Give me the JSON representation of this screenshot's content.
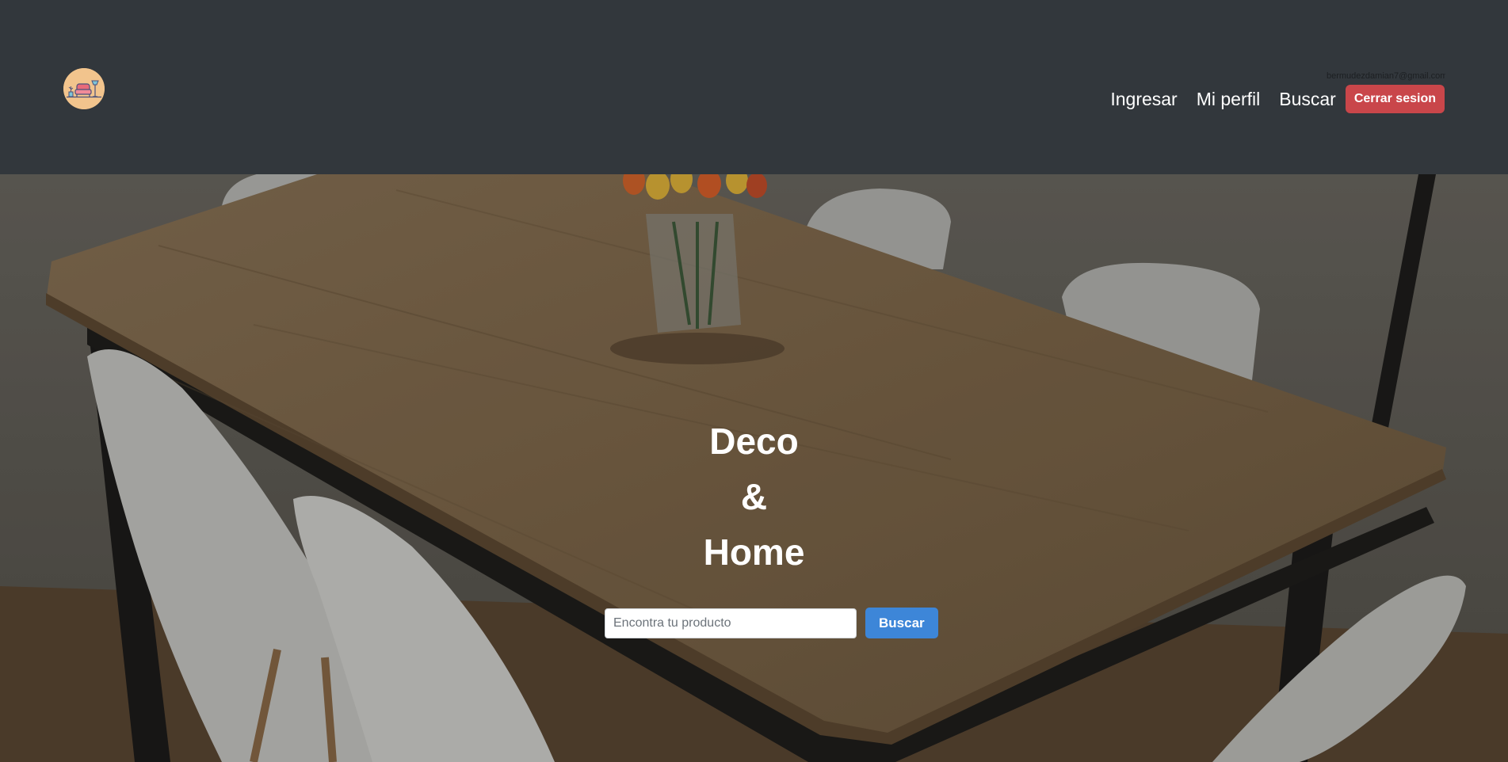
{
  "navbar": {
    "logo_icon": "furniture-logo-icon",
    "user_email": "bermudezdamian7@gmail.com",
    "links": {
      "login": "Ingresar",
      "profile": "Mi perfil",
      "search": "Buscar"
    },
    "logout_label": "Cerrar sesion"
  },
  "hero": {
    "background_image": "dining-table-with-white-chairs-and-tulips",
    "title_lines": [
      "Deco",
      "&",
      "Home"
    ],
    "search": {
      "placeholder": "Encontra tu producto",
      "value": "",
      "button_label": "Buscar"
    }
  },
  "colors": {
    "navbar_bg": "#32373c",
    "logout_button": "#c9464a",
    "search_button": "#3d86d8",
    "logo_bg": "#f2c48d"
  }
}
